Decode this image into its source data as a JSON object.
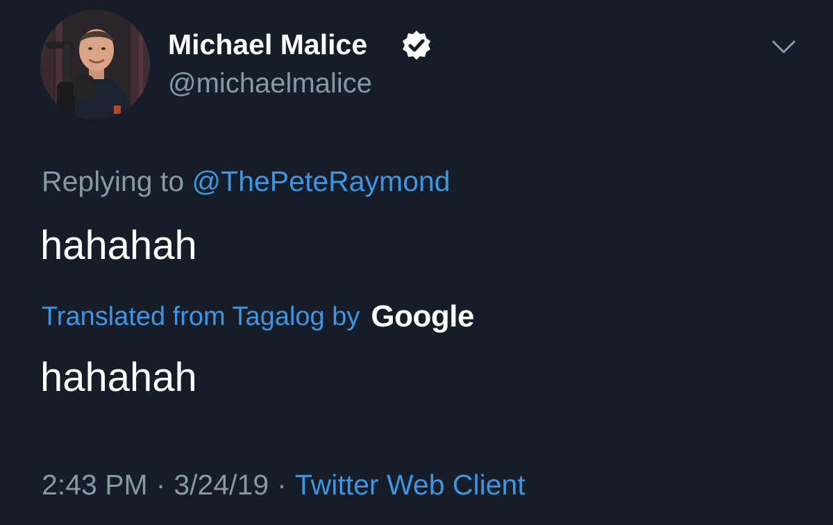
{
  "author": {
    "display_name": "Michael Malice",
    "handle": "@michaelmalice",
    "verified": true,
    "avatar": "profile-photo"
  },
  "reply": {
    "prefix": "Replying to",
    "mention": "@ThePeteRaymond"
  },
  "tweet": {
    "text": "hahahah",
    "translation_label": "Translated from Tagalog by",
    "translation_provider": "Google",
    "translated_text": "hahahah"
  },
  "meta": {
    "time": "2:43 PM",
    "date": "3/24/19",
    "separator": "·",
    "client": "Twitter Web Client"
  },
  "icons": {
    "verified": "verified-badge-icon",
    "more": "chevron-down-icon"
  },
  "colors": {
    "background": "#161d29",
    "primary_text": "#ffffff",
    "secondary_text": "#8899a6",
    "link": "#3d96e2"
  }
}
